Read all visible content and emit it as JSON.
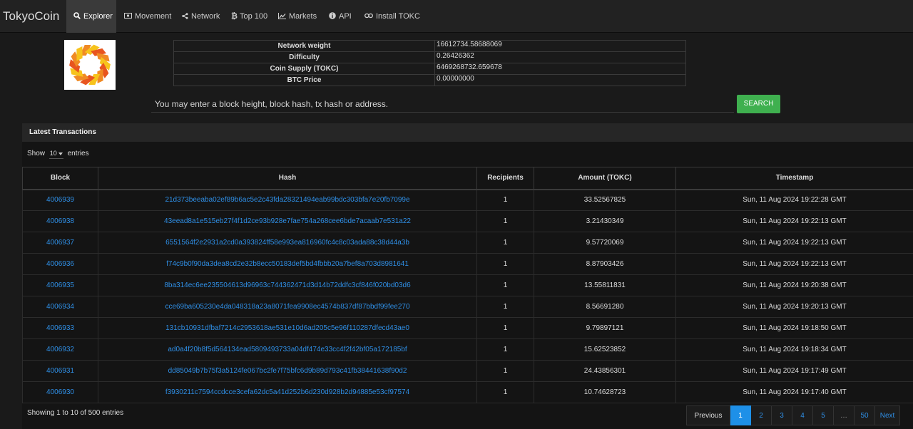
{
  "brand": "TokyoCoin",
  "nav": [
    {
      "label": "Explorer",
      "icon": "search-icon",
      "active": true
    },
    {
      "label": "Movement",
      "icon": "money-icon"
    },
    {
      "label": "Network",
      "icon": "share-icon"
    },
    {
      "label": "Top 100",
      "icon": "bitcoin-icon"
    },
    {
      "label": "Markets",
      "icon": "line-chart-icon"
    },
    {
      "label": "API",
      "icon": "info-circle-icon"
    },
    {
      "label": "Install TOKC",
      "icon": "link-icon"
    }
  ],
  "summary": {
    "network_weight_label": "Network weight",
    "network_weight": "16612734.58688069",
    "difficulty_label": "Difficulty",
    "difficulty": "0.26426362",
    "supply_label": "Coin Supply (TOKC)",
    "supply": "6469268732.659678",
    "btc_price_label": "BTC Price",
    "btc_price": "0.00000000"
  },
  "search": {
    "placeholder": "You may enter a block height, block hash, tx hash or address.",
    "button_label": "SEARCH"
  },
  "latest": {
    "title": "Latest Transactions",
    "show_prefix": "Show",
    "show_value": "10",
    "show_suffix": "entries",
    "columns": [
      "Block",
      "Hash",
      "Recipients",
      "Amount (TOKC)",
      "Timestamp"
    ],
    "rows": [
      {
        "block": "4006939",
        "hash": "21d373beeaba02ef89b6ac5e2c43fda28321494eab99bdc303bfa7e20fb7099e",
        "recipients": "1",
        "amount": "33.52567825",
        "timestamp": "Sun, 11 Aug 2024 19:22:28 GMT"
      },
      {
        "block": "4006938",
        "hash": "43eead8a1e515eb27f4f1d2ce93b928e7fae754a268cee6bde7acaab7e531a22",
        "recipients": "1",
        "amount": "3.21430349",
        "timestamp": "Sun, 11 Aug 2024 19:22:13 GMT"
      },
      {
        "block": "4006937",
        "hash": "6551564f2e2931a2cd0a393824ff58e993ea816960fc4c8c03ada88c38d44a3b",
        "recipients": "1",
        "amount": "9.57720069",
        "timestamp": "Sun, 11 Aug 2024 19:22:13 GMT"
      },
      {
        "block": "4006936",
        "hash": "f74c9b0f90da3dea8cd2e32b8ecc50183def5bd4fbbb20a7bef8a703d8981641",
        "recipients": "1",
        "amount": "8.87903426",
        "timestamp": "Sun, 11 Aug 2024 19:22:13 GMT"
      },
      {
        "block": "4006935",
        "hash": "8ba314ec6ee235504613d96963c744362471d3d14b72ddfc3cf846f020bd03d6",
        "recipients": "1",
        "amount": "13.55811831",
        "timestamp": "Sun, 11 Aug 2024 19:20:38 GMT"
      },
      {
        "block": "4006934",
        "hash": "cce69ba605230e4da048318a23a8071fea9908ec4574b837df87bbdf99fee270",
        "recipients": "1",
        "amount": "8.56691280",
        "timestamp": "Sun, 11 Aug 2024 19:20:13 GMT"
      },
      {
        "block": "4006933",
        "hash": "131cb10931dfbaf7214c2953618ae531e10d6ad205c5e96f110287dfecd43ae0",
        "recipients": "1",
        "amount": "9.79897121",
        "timestamp": "Sun, 11 Aug 2024 19:18:50 GMT"
      },
      {
        "block": "4006932",
        "hash": "ad0a4f20b8f5d564134ead5809493733a04df474e33cc4f2f42bf05a172185bf",
        "recipients": "1",
        "amount": "15.62523852",
        "timestamp": "Sun, 11 Aug 2024 19:18:34 GMT"
      },
      {
        "block": "4006931",
        "hash": "dd85049b7b75f3a5124fe067bc2fe7f75bfc6d9b89d793c41fb38441638f90d2",
        "recipients": "1",
        "amount": "24.43856301",
        "timestamp": "Sun, 11 Aug 2024 19:17:49 GMT"
      },
      {
        "block": "4006930",
        "hash": "f3930211c7594ccdcce3cefa62dc5a41d252b6d230d928b2d94885e53cf97574",
        "recipients": "1",
        "amount": "10.74628723",
        "timestamp": "Sun, 11 Aug 2024 19:17:40 GMT"
      }
    ],
    "info": "Showing 1 to 10 of 500 entries",
    "pagination": {
      "prev": "Previous",
      "pages": [
        "1",
        "2",
        "3",
        "4",
        "5",
        "…",
        "50"
      ],
      "current": "1",
      "next": "Next"
    }
  },
  "colors": {
    "link": "#2f8fe6",
    "search_button": "#3fb04f",
    "active_page": "#1e90e8",
    "logo_orange": "#f08a24",
    "logo_yellow": "#f7c31b"
  }
}
